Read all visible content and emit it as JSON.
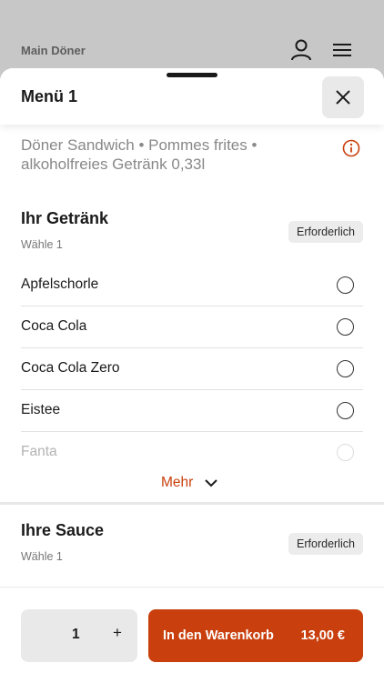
{
  "app": {
    "title": "Main Döner"
  },
  "icons": {
    "user": "user-icon",
    "menu": "hamburger-menu-icon",
    "close": "close-icon",
    "info": "info-icon",
    "chevron": "chevron-down-icon"
  },
  "colors": {
    "accent": "#c9400e",
    "badge_bg": "#ececec",
    "button_bg": "#e9e9e9"
  },
  "sheet": {
    "title": "Menü 1",
    "description": "Döner Sandwich • Pommes frites • alkoholfreies Getränk 0,33l"
  },
  "drink_section": {
    "title": "Ihr Getränk",
    "subtitle": "Wähle 1",
    "badge": "Erforderlich",
    "options": [
      "Apfelschorle",
      "Coca Cola",
      "Coca Cola Zero",
      "Eistee",
      "Fanta"
    ],
    "more_label": "Mehr"
  },
  "sauce_section": {
    "title": "Ihre Sauce",
    "subtitle": "Wähle 1",
    "badge": "Erforderlich"
  },
  "footer": {
    "quantity": "1",
    "plus": "+",
    "add_to_cart_label": "In den Warenkorb",
    "price": "13,00 €"
  }
}
